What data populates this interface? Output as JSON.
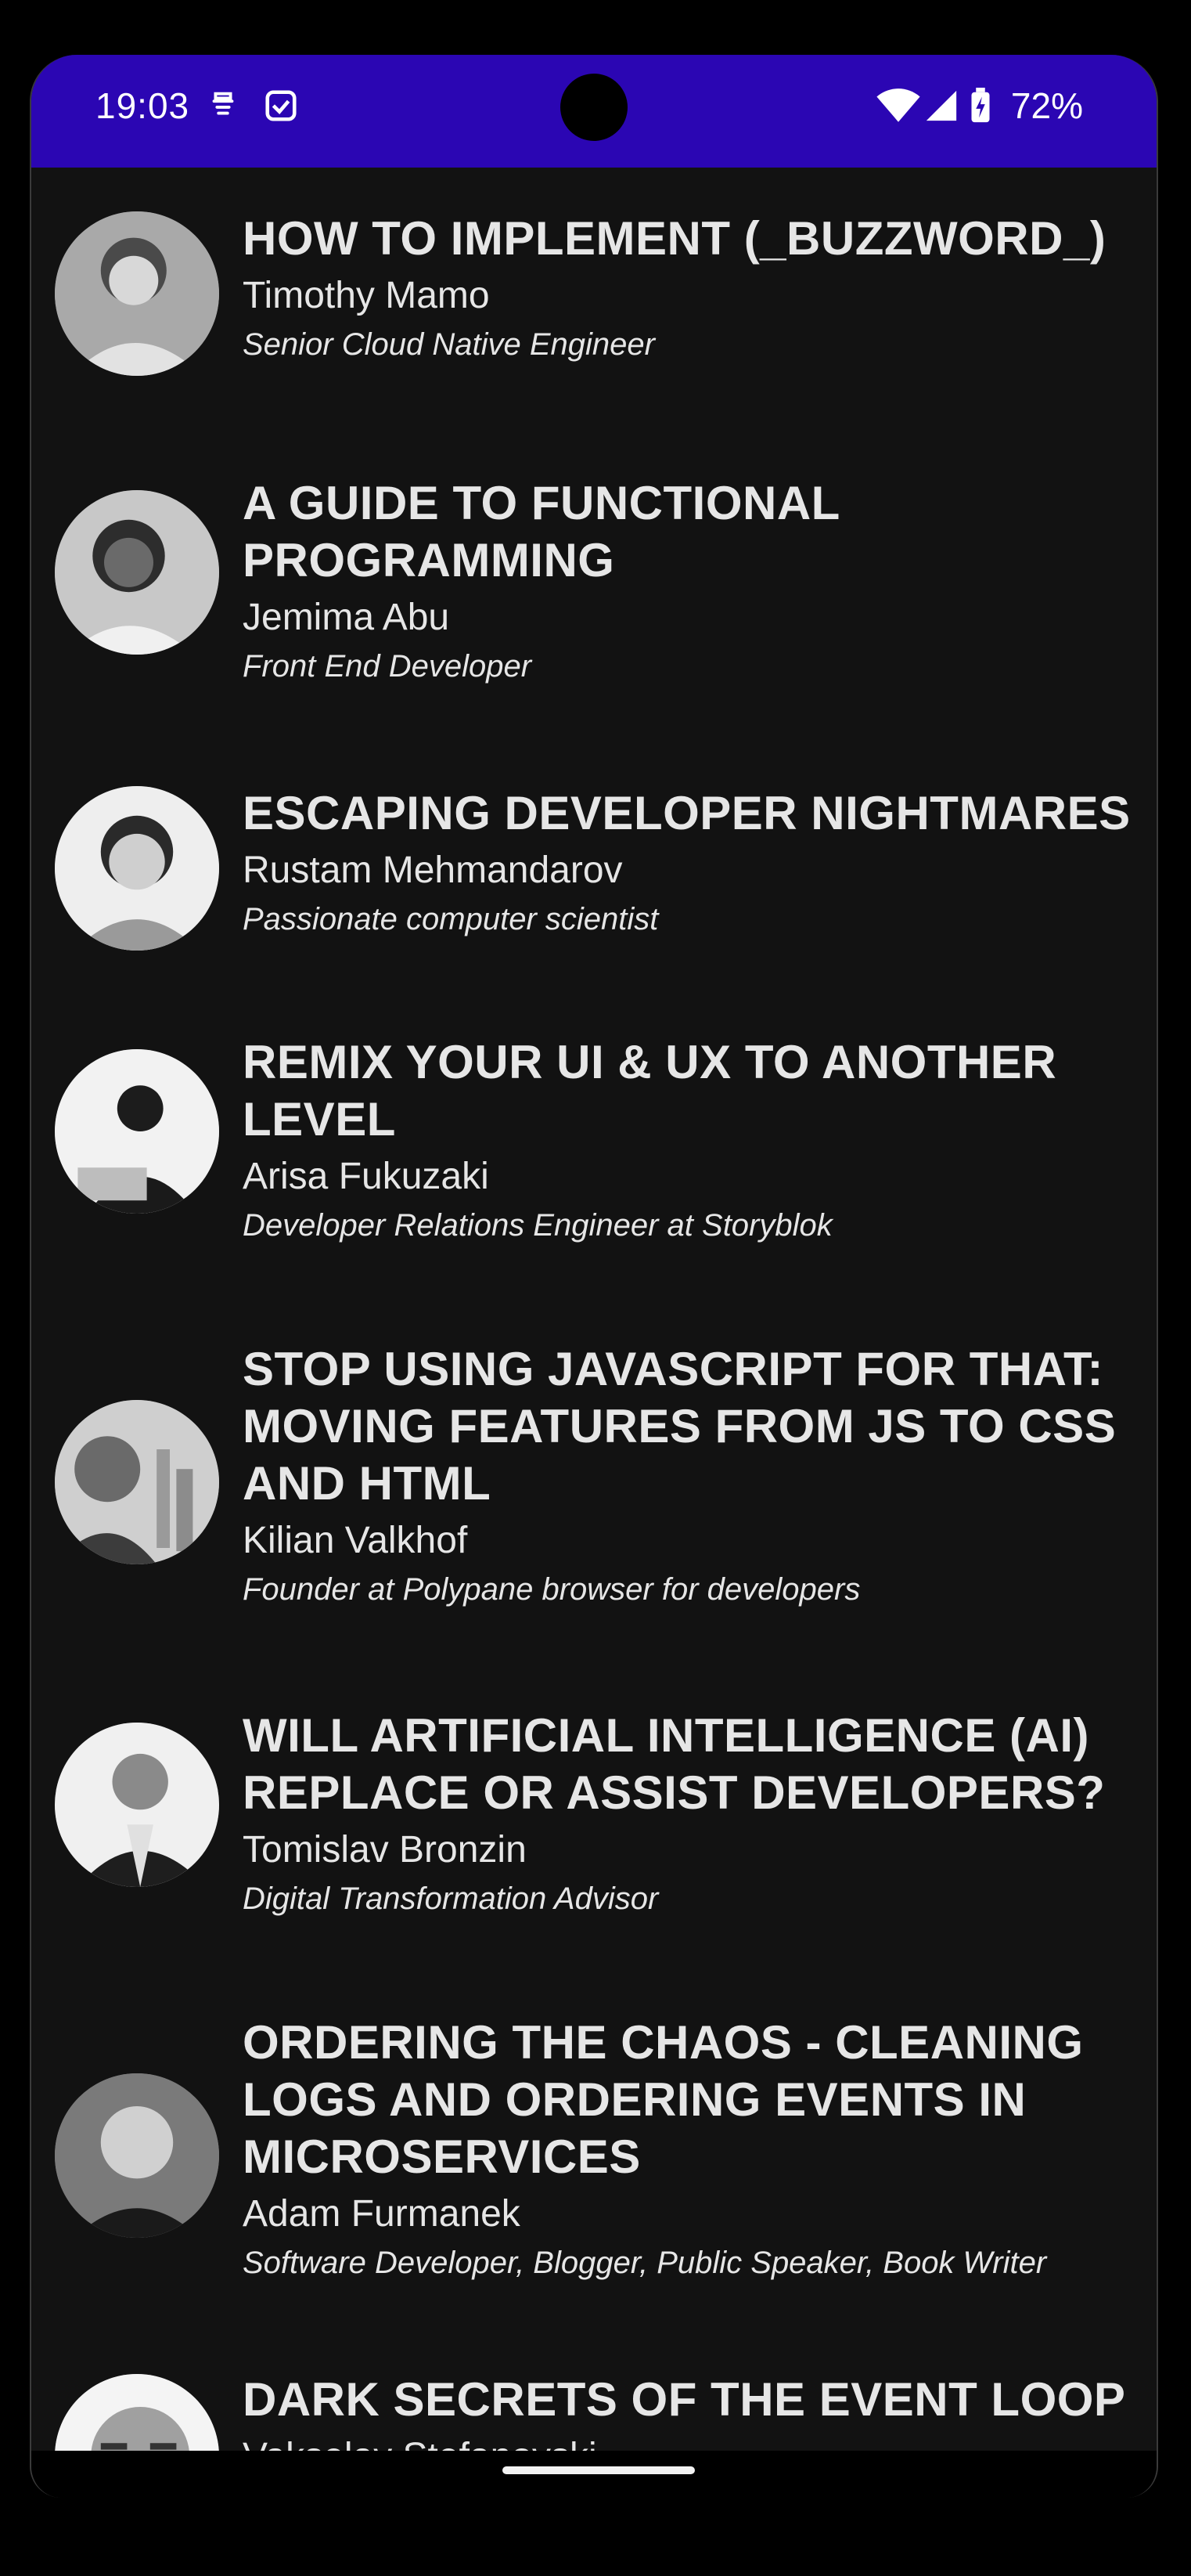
{
  "status_bar": {
    "time": "19:03",
    "battery": "72%",
    "icons": [
      "face-unlock-icon",
      "checkbox-icon",
      "wifi-icon",
      "signal-icon",
      "battery-charging-icon"
    ],
    "color": "#2b06b3"
  },
  "talks": [
    {
      "title": "HOW TO IMPLEMENT (_BUZZWORD_)",
      "speaker": "Timothy Mamo",
      "role": "Senior Cloud Native Engineer"
    },
    {
      "title": "A GUIDE TO FUNCTIONAL PROGRAMMING",
      "speaker": "Jemima Abu",
      "role": "Front End Developer"
    },
    {
      "title": "ESCAPING DEVELOPER NIGHTMARES",
      "speaker": "Rustam Mehmandarov",
      "role": "Passionate computer scientist"
    },
    {
      "title": "REMIX YOUR UI & UX TO ANOTHER LEVEL",
      "speaker": "Arisa Fukuzaki",
      "role": "Developer Relations Engineer at Storyblok"
    },
    {
      "title": "STOP USING JAVASCRIPT FOR THAT: MOVING FEATURES FROM JS TO CSS AND HTML",
      "speaker": "Kilian Valkhof",
      "role": "Founder at Polypane browser for developers"
    },
    {
      "title": "WILL ARTIFICIAL INTELLIGENCE (AI) REPLACE OR ASSIST DEVELOPERS?",
      "speaker": "Tomislav Bronzin",
      "role": "Digital Transformation Advisor"
    },
    {
      "title": "ORDERING THE CHAOS - CLEANING LOGS AND ORDERING EVENTS IN MICROSERVICES",
      "speaker": "Adam Furmanek",
      "role": "Software Developer, Blogger, Public Speaker, Book Writer"
    },
    {
      "title": "DARK SECRETS OF THE EVENT LOOP",
      "speaker": "Vakselav Stefanovski",
      "role": ""
    }
  ]
}
